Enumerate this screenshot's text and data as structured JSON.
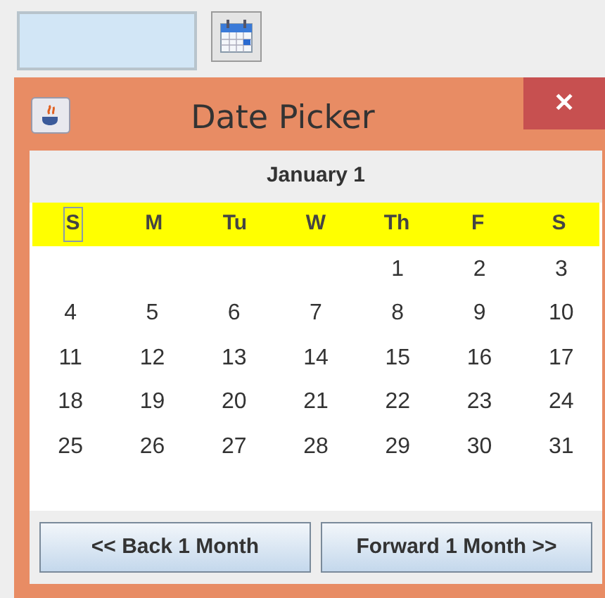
{
  "dialog": {
    "title": "Date Picker"
  },
  "month_title": "January 1",
  "weekdays": [
    {
      "label": "S",
      "focused": true
    },
    {
      "label": "M",
      "focused": false
    },
    {
      "label": "Tu",
      "focused": false
    },
    {
      "label": "W",
      "focused": false
    },
    {
      "label": "Th",
      "focused": false
    },
    {
      "label": "F",
      "focused": false
    },
    {
      "label": "S",
      "focused": false
    }
  ],
  "weeks": [
    [
      {
        "kind": "blank"
      },
      {
        "kind": "blank"
      },
      {
        "kind": "blank"
      },
      {
        "kind": "blank"
      },
      {
        "kind": "day",
        "label": "1"
      },
      {
        "kind": "day",
        "label": "2"
      },
      {
        "kind": "day",
        "label": "3"
      }
    ],
    [
      {
        "kind": "day",
        "label": "4"
      },
      {
        "kind": "day",
        "label": "5"
      },
      {
        "kind": "day",
        "label": "6"
      },
      {
        "kind": "day",
        "label": "7"
      },
      {
        "kind": "day",
        "label": "8"
      },
      {
        "kind": "day",
        "label": "9"
      },
      {
        "kind": "day",
        "label": "10"
      }
    ],
    [
      {
        "kind": "day",
        "label": "11"
      },
      {
        "kind": "day",
        "label": "12"
      },
      {
        "kind": "day",
        "label": "13"
      },
      {
        "kind": "day",
        "label": "14"
      },
      {
        "kind": "day",
        "label": "15"
      },
      {
        "kind": "day",
        "label": "16"
      },
      {
        "kind": "day",
        "label": "17"
      }
    ],
    [
      {
        "kind": "day",
        "label": "18"
      },
      {
        "kind": "day",
        "label": "19"
      },
      {
        "kind": "day",
        "label": "20"
      },
      {
        "kind": "day",
        "label": "21"
      },
      {
        "kind": "day",
        "label": "22"
      },
      {
        "kind": "day",
        "label": "23"
      },
      {
        "kind": "day",
        "label": "24"
      }
    ],
    [
      {
        "kind": "day",
        "label": "25"
      },
      {
        "kind": "day",
        "label": "26"
      },
      {
        "kind": "day",
        "label": "27"
      },
      {
        "kind": "day",
        "label": "28"
      },
      {
        "kind": "day",
        "label": "29"
      },
      {
        "kind": "day",
        "label": "30"
      },
      {
        "kind": "day",
        "label": "31"
      }
    ]
  ],
  "buttons": [
    "<< Back 1 Month",
    "Forward 1 Month >>"
  ],
  "close_glyph": "✕"
}
